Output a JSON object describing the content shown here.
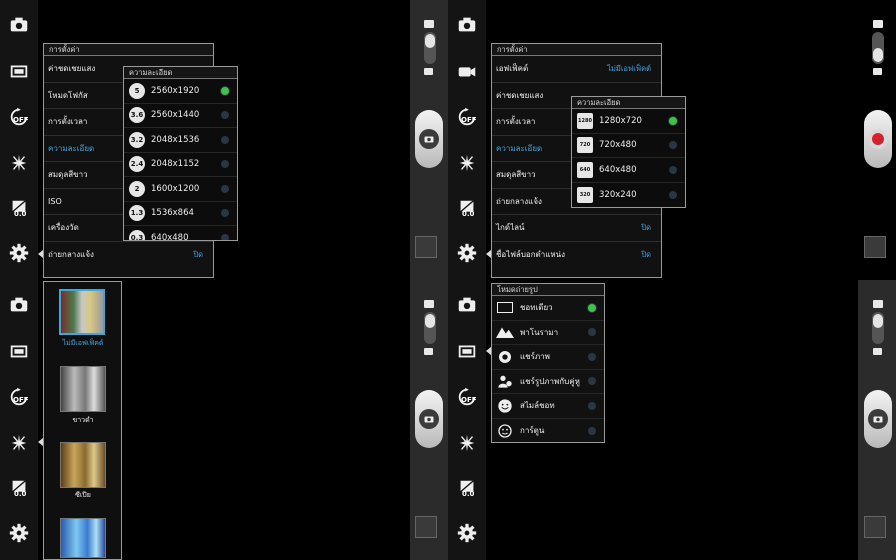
{
  "toolbar_icons": [
    "switch-camera-icon",
    "shot-mode-icon",
    "timer-off-icon",
    "effects-icon",
    "exposure-icon",
    "settings-gear-icon"
  ],
  "toolbar_badges": {
    "timer": "OFF",
    "exposure": "0.0"
  },
  "photo_settings": {
    "title": "การตั้งค่า",
    "rows": [
      {
        "label": "ค่าชดเชยแสง",
        "value": ""
      },
      {
        "label": "โหมดโฟกัส",
        "value": ""
      },
      {
        "label": "การตั้งเวลา",
        "value": ""
      },
      {
        "label": "ความละเอียด",
        "value": ""
      },
      {
        "label": "สมดุลสีขาว",
        "value": ""
      },
      {
        "label": "ISO",
        "value": ""
      },
      {
        "label": "เครื่องวัด",
        "value": ""
      },
      {
        "label": "ถ่ายกลางแจ้ง",
        "value": "ปิด"
      }
    ]
  },
  "photo_resolution": {
    "title": "ความละเอียด",
    "options": [
      {
        "badge": "5",
        "label": "2560x1920",
        "selected": true
      },
      {
        "badge": "3.6",
        "label": "2560x1440",
        "selected": false
      },
      {
        "badge": "3.2",
        "label": "2048x1536",
        "selected": false
      },
      {
        "badge": "2.4",
        "label": "2048x1152",
        "selected": false
      },
      {
        "badge": "2",
        "label": "1600x1200",
        "selected": false
      },
      {
        "badge": "1.3",
        "label": "1536x864",
        "selected": false
      },
      {
        "badge": "0.3",
        "label": "640x480",
        "selected": false
      }
    ]
  },
  "effects": {
    "items": [
      {
        "label": "ไม่มีเอฟเฟ็คต์",
        "selected": true
      },
      {
        "label": "ขาวดำ",
        "selected": false
      },
      {
        "label": "ซีเปีย",
        "selected": false
      },
      {
        "label": "",
        "selected": false
      }
    ]
  },
  "video_settings": {
    "title": "การตั้งค่า",
    "rows": [
      {
        "label": "เอฟเฟ็คต์",
        "value": "ไม่มีเอฟเฟ็คต์"
      },
      {
        "label": "ค่าชดเชยแสง",
        "value": ""
      },
      {
        "label": "การตั้งเวลา",
        "value": ""
      },
      {
        "label": "ความละเอียด",
        "value": ""
      },
      {
        "label": "สมดุลสีขาว",
        "value": ""
      },
      {
        "label": "ถ่ายกลางแจ้ง",
        "value": ""
      },
      {
        "label": "ไกด์ไลน์",
        "value": "ปิด"
      },
      {
        "label": "ชื่อไฟล์บอกตำแหน่ง",
        "value": "ปิด"
      }
    ]
  },
  "video_resolution": {
    "title": "ความละเอียด",
    "options": [
      {
        "badge": "1280",
        "label": "1280x720",
        "selected": true
      },
      {
        "badge": "720",
        "label": "720x480",
        "selected": false
      },
      {
        "badge": "640",
        "label": "640x480",
        "selected": false
      },
      {
        "badge": "320",
        "label": "320x240",
        "selected": false
      }
    ]
  },
  "shooting_mode": {
    "title": "โหมดถ่ายรูป",
    "options": [
      {
        "icon": "single-shot-icon",
        "label": "ชอทเดียว",
        "selected": true
      },
      {
        "icon": "panorama-icon",
        "label": "พาโนรามา",
        "selected": false
      },
      {
        "icon": "share-shot-icon",
        "label": "แชร์ภาพ",
        "selected": false
      },
      {
        "icon": "buddy-share-icon",
        "label": "แชร์รูปภาพกับคู่หู",
        "selected": false
      },
      {
        "icon": "smile-shot-icon",
        "label": "สไมล์ชอท",
        "selected": false
      },
      {
        "icon": "cartoon-icon",
        "label": "การ์ตูน",
        "selected": false
      }
    ]
  },
  "colors": {
    "accent": "#3da8e0",
    "radio_on": "#3fc24a",
    "record": "#d3212d"
  }
}
